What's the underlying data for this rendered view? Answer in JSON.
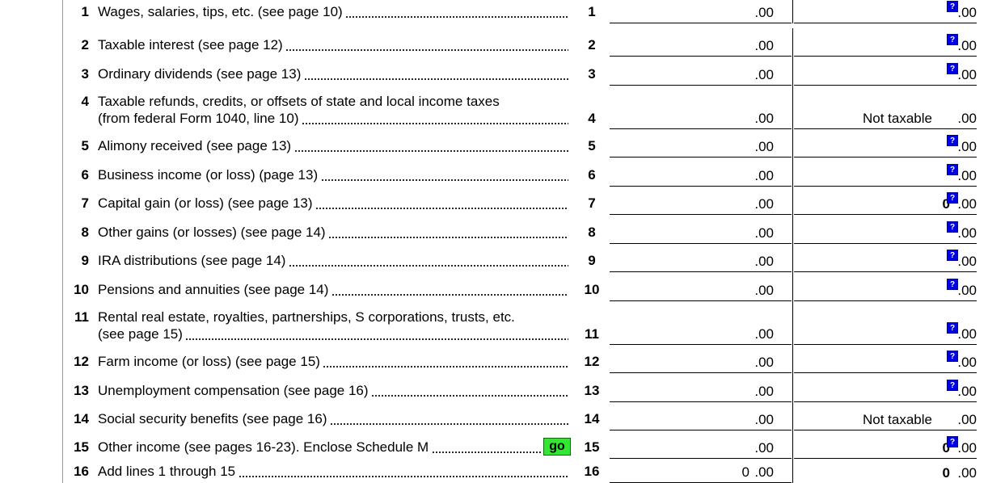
{
  "form": {
    "cents": ".00",
    "not_taxable": "Not taxable",
    "help_glyph": "?",
    "go_label": "go",
    "lines": [
      {
        "num": "1",
        "text": "Wages, salaries, tips, etc. (see page 10)",
        "line": "1",
        "fed": "",
        "state": "",
        "state_help": true
      },
      {
        "num": "2",
        "text": "Taxable interest (see page 12)",
        "line": "2",
        "fed": "",
        "state": "",
        "state_help": true
      },
      {
        "num": "3",
        "text": "Ordinary dividends (see page 13)",
        "line": "3",
        "fed": "",
        "state": "",
        "state_help": true
      },
      {
        "num": "4",
        "text": "Taxable refunds, credits, or offsets of state and local income taxes",
        "text2": "(from federal Form 1040, line 10)",
        "line": "4",
        "fed": "",
        "state": "",
        "state_not_taxable": true
      },
      {
        "num": "5",
        "text": "Alimony received (see page 13)",
        "line": "5",
        "fed": "",
        "state": "",
        "state_help": true
      },
      {
        "num": "6",
        "text": "Business income (or loss) (page 13)",
        "line": "6",
        "fed": "",
        "state": "",
        "state_help": true
      },
      {
        "num": "7",
        "text": "Capital gain (or loss) (see page 13)",
        "line": "7",
        "fed": "",
        "state": "0",
        "state_help": true
      },
      {
        "num": "8",
        "text": "Other gains (or losses) (see page 14)",
        "line": "8",
        "fed": "",
        "state": "",
        "state_help": true
      },
      {
        "num": "9",
        "text": "IRA distributions (see page 14)",
        "line": "9",
        "fed": "",
        "state": "",
        "state_help": true
      },
      {
        "num": "10",
        "text": "Pensions and annuities (see page 14)",
        "line": "10",
        "fed": "",
        "state": "",
        "state_help": true
      },
      {
        "num": "11",
        "text": "Rental real estate, royalties, partnerships, S corporations, trusts, etc.",
        "text2": "(see page 15)",
        "line": "11",
        "fed": "",
        "state": "",
        "state_help": true
      },
      {
        "num": "12",
        "text": "Farm income (or loss) (see page 15)",
        "line": "12",
        "fed": "",
        "state": "",
        "state_help": true
      },
      {
        "num": "13",
        "text": "Unemployment compensation (see page 16)",
        "line": "13",
        "fed": "",
        "state": "",
        "state_help": true
      },
      {
        "num": "14",
        "text": "Social security benefits (see page 16)",
        "line": "14",
        "fed": "",
        "state": "",
        "state_not_taxable": true
      },
      {
        "num": "15",
        "text": "Other income (see pages 16-23). Enclose Schedule M",
        "line": "15",
        "fed": "",
        "state": "0",
        "state_help": true,
        "go": true
      },
      {
        "num": "16",
        "text": "Add lines 1 through 15",
        "line": "16",
        "fed": "0",
        "state": "0"
      }
    ]
  }
}
